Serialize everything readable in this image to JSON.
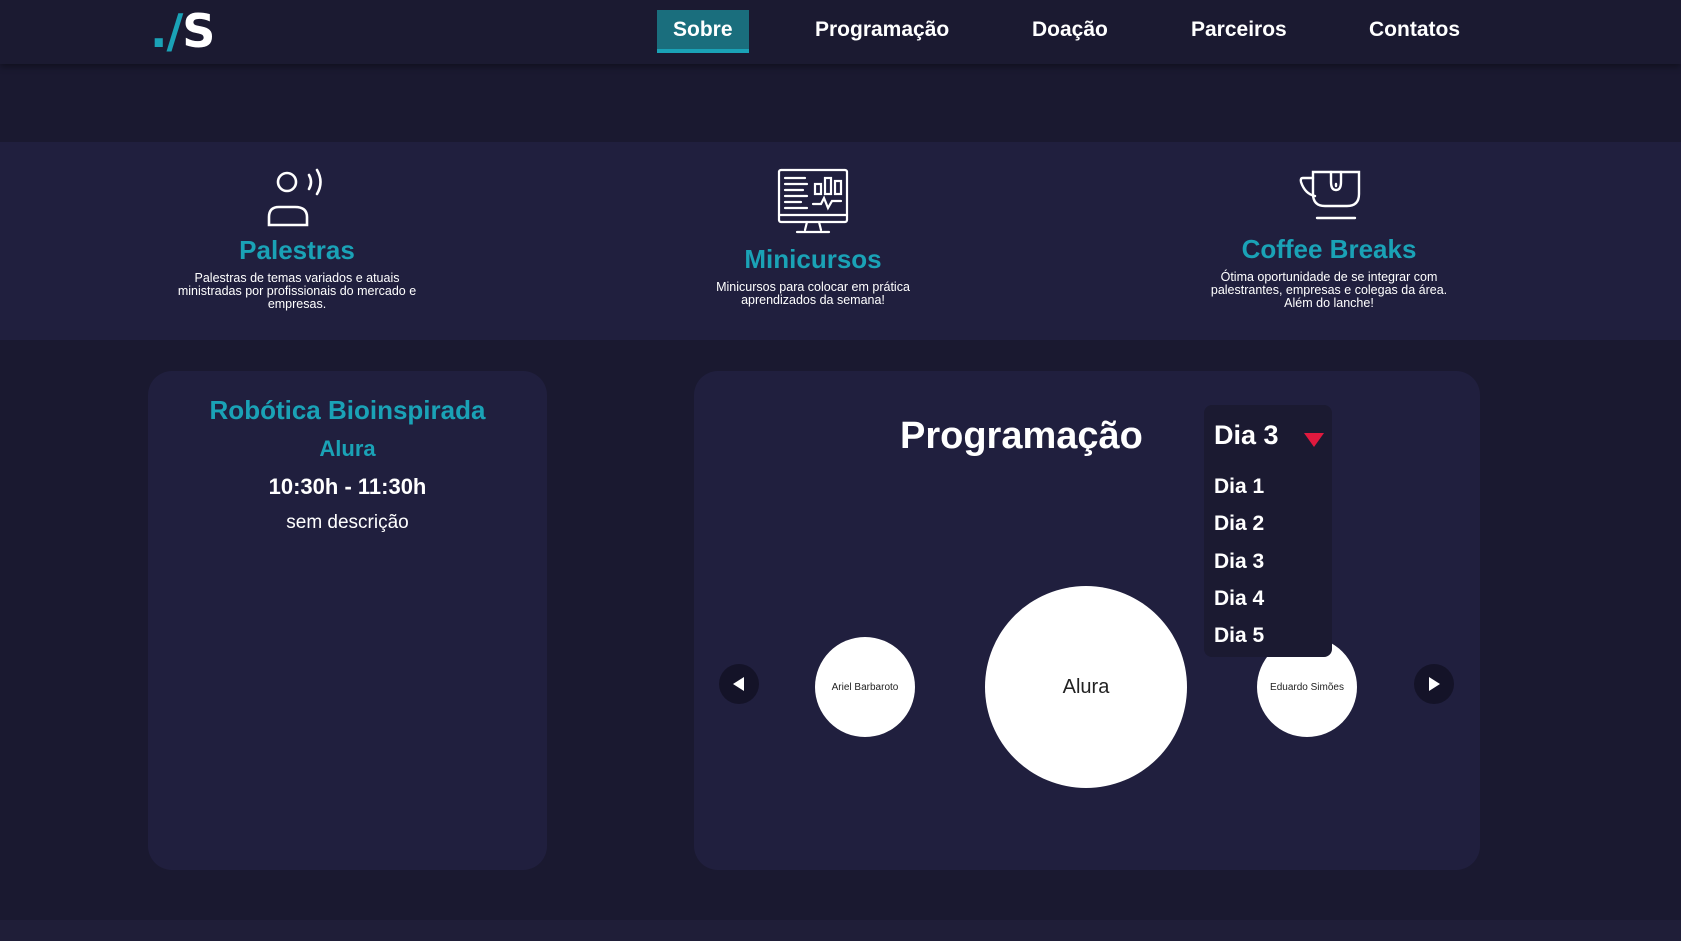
{
  "logo": {
    "dot": ".",
    "slash": "/",
    "letter": "S"
  },
  "nav": [
    {
      "label": "Sobre",
      "active": true
    },
    {
      "label": "Programação",
      "active": false
    },
    {
      "label": "Doação",
      "active": false
    },
    {
      "label": "Parceiros",
      "active": false
    },
    {
      "label": "Contatos",
      "active": false
    }
  ],
  "features": [
    {
      "icon": "speaker-icon",
      "title": "Palestras",
      "desc_lines": [
        "Palestras de temas variados e atuais",
        "ministradas por profissionais do mercado e",
        "empresas."
      ]
    },
    {
      "icon": "monitor-dashboard-icon",
      "title": "Minicursos",
      "desc_lines": [
        "Minicursos para colocar em prática",
        "aprendizados da semana!"
      ]
    },
    {
      "icon": "coffee-cup-icon",
      "title": "Coffee Breaks",
      "desc_lines": [
        "Ótima oportunidade de se integrar com",
        "palestrantes, empresas e colegas da área.",
        "Além do lanche!"
      ]
    }
  ],
  "detail": {
    "title": "Robótica Bioinspirada",
    "speaker": "Alura",
    "time": "10:30h - 11:30h",
    "description": "sem descrição"
  },
  "schedule": {
    "title": "Programação",
    "selected_day": "Dia 3",
    "day_options": [
      "Dia 1",
      "Dia 2",
      "Dia 3",
      "Dia 4",
      "Dia 5"
    ],
    "carousel": {
      "prev": "Ariel Barbaroto",
      "current": "Alura",
      "next": "Eduardo Simões"
    }
  },
  "colors": {
    "accent": "#1aa2b6",
    "background": "#1a1930",
    "card": "#201f3e",
    "caret": "#e0193e"
  }
}
